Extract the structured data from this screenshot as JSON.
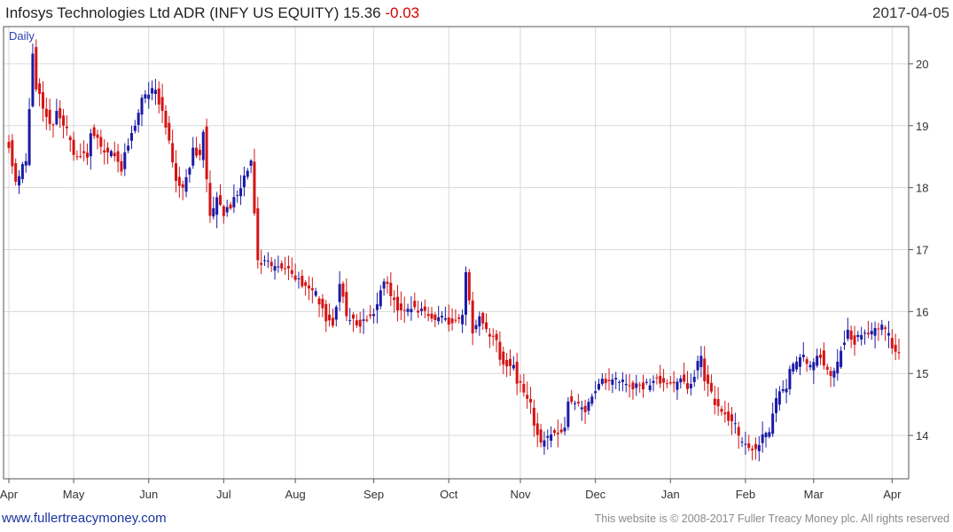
{
  "header": {
    "security": "Infosys Technologies Ltd ADR (INFY US EQUITY)",
    "last_price": "15.36",
    "change": "-0.03",
    "date": "2017-04-05"
  },
  "footer": {
    "site_link": "www.fullertreacymoney.com",
    "copyright": "This website is © 2008-2017 Fuller Treacy Money plc. All rights reserved"
  },
  "colors": {
    "up": "#1a1aa6",
    "down": "#d41414",
    "grid": "#d9d9d9",
    "frame": "#555555"
  },
  "chart_data": {
    "type": "candlestick",
    "period_label": "Daily",
    "ylim": [
      13.3,
      20.6
    ],
    "y_ticks": [
      14,
      15,
      16,
      17,
      18,
      19,
      20
    ],
    "y_axis_side": "right",
    "x_ticks": [
      "Apr",
      "May",
      "Jun",
      "Jul",
      "Aug",
      "Sep",
      "Oct",
      "Nov",
      "Dec",
      "Jan",
      "Feb",
      "Mar",
      "Apr"
    ],
    "grid": true,
    "anchor_closes": [
      [
        "2016-04-05",
        18.7
      ],
      [
        "2016-04-07",
        18.1
      ],
      [
        "2016-04-12",
        18.4
      ],
      [
        "2016-04-14",
        20.2
      ],
      [
        "2016-04-15",
        19.6
      ],
      [
        "2016-04-18",
        19.5
      ],
      [
        "2016-04-21",
        19.0
      ],
      [
        "2016-04-25",
        19.2
      ],
      [
        "2016-04-29",
        18.8
      ],
      [
        "2016-05-03",
        18.5
      ],
      [
        "2016-05-06",
        18.5
      ],
      [
        "2016-05-09",
        18.9
      ],
      [
        "2016-05-13",
        18.6
      ],
      [
        "2016-05-17",
        18.6
      ],
      [
        "2016-05-20",
        18.3
      ],
      [
        "2016-05-24",
        18.7
      ],
      [
        "2016-05-27",
        19.2
      ],
      [
        "2016-06-02",
        19.6
      ],
      [
        "2016-06-06",
        19.4
      ],
      [
        "2016-06-07",
        19.3
      ],
      [
        "2016-06-10",
        18.4
      ],
      [
        "2016-06-15",
        18.0
      ],
      [
        "2016-06-17",
        18.3
      ],
      [
        "2016-06-20",
        18.6
      ],
      [
        "2016-06-22",
        18.5
      ],
      [
        "2016-06-23",
        18.9
      ],
      [
        "2016-06-24",
        18.1
      ],
      [
        "2016-06-27",
        17.5
      ],
      [
        "2016-06-29",
        17.8
      ],
      [
        "2016-07-01",
        17.6
      ],
      [
        "2016-07-05",
        17.7
      ],
      [
        "2016-07-08",
        18.0
      ],
      [
        "2016-07-13",
        18.4
      ],
      [
        "2016-07-15",
        16.8
      ],
      [
        "2016-07-19",
        16.8
      ],
      [
        "2016-07-22",
        16.7
      ],
      [
        "2016-07-28",
        16.7
      ],
      [
        "2016-08-02",
        16.5
      ],
      [
        "2016-08-05",
        16.4
      ],
      [
        "2016-08-09",
        16.3
      ],
      [
        "2016-08-12",
        15.9
      ],
      [
        "2016-08-16",
        15.8
      ],
      [
        "2016-08-18",
        16.4
      ],
      [
        "2016-08-22",
        15.9
      ],
      [
        "2016-08-26",
        15.8
      ],
      [
        "2016-08-31",
        15.9
      ],
      [
        "2016-09-06",
        16.5
      ],
      [
        "2016-09-09",
        16.2
      ],
      [
        "2016-09-13",
        16.0
      ],
      [
        "2016-09-16",
        16.1
      ],
      [
        "2016-09-21",
        16.0
      ],
      [
        "2016-09-26",
        15.9
      ],
      [
        "2016-09-30",
        15.9
      ],
      [
        "2016-10-04",
        15.8
      ],
      [
        "2016-10-07",
        15.9
      ],
      [
        "2016-10-10",
        16.6
      ],
      [
        "2016-10-12",
        15.7
      ],
      [
        "2016-10-14",
        15.9
      ],
      [
        "2016-10-18",
        15.7
      ],
      [
        "2016-10-21",
        15.5
      ],
      [
        "2016-10-25",
        15.2
      ],
      [
        "2016-10-28",
        15.1
      ],
      [
        "2016-11-01",
        14.8
      ],
      [
        "2016-11-03",
        14.6
      ],
      [
        "2016-11-07",
        14.2
      ],
      [
        "2016-11-09",
        13.9
      ],
      [
        "2016-11-14",
        14.0
      ],
      [
        "2016-11-18",
        14.1
      ],
      [
        "2016-11-21",
        14.6
      ],
      [
        "2016-11-23",
        14.5
      ],
      [
        "2016-11-28",
        14.4
      ],
      [
        "2016-11-30",
        14.6
      ],
      [
        "2016-12-02",
        14.8
      ],
      [
        "2016-12-06",
        14.9
      ],
      [
        "2016-12-12",
        14.9
      ],
      [
        "2016-12-16",
        14.8
      ],
      [
        "2016-12-21",
        14.8
      ],
      [
        "2016-12-27",
        14.9
      ],
      [
        "2017-01-03",
        14.8
      ],
      [
        "2017-01-05",
        14.9
      ],
      [
        "2017-01-09",
        14.7
      ],
      [
        "2017-01-11",
        15.0
      ],
      [
        "2017-01-13",
        15.3
      ],
      [
        "2017-01-17",
        14.8
      ],
      [
        "2017-01-19",
        14.5
      ],
      [
        "2017-01-23",
        14.4
      ],
      [
        "2017-01-26",
        14.2
      ],
      [
        "2017-01-31",
        13.9
      ],
      [
        "2017-02-02",
        13.8
      ],
      [
        "2017-02-06",
        13.8
      ],
      [
        "2017-02-08",
        14.0
      ],
      [
        "2017-02-10",
        14.1
      ],
      [
        "2017-02-13",
        14.4
      ],
      [
        "2017-02-15",
        14.7
      ],
      [
        "2017-02-17",
        14.8
      ],
      [
        "2017-02-21",
        15.1
      ],
      [
        "2017-02-24",
        15.3
      ],
      [
        "2017-02-28",
        15.1
      ],
      [
        "2017-03-03",
        15.3
      ],
      [
        "2017-03-08",
        15.0
      ],
      [
        "2017-03-13",
        15.4
      ],
      [
        "2017-03-15",
        15.7
      ],
      [
        "2017-03-17",
        15.5
      ],
      [
        "2017-03-21",
        15.6
      ],
      [
        "2017-03-24",
        15.7
      ],
      [
        "2017-03-29",
        15.8
      ],
      [
        "2017-03-31",
        15.6
      ],
      [
        "2017-04-03",
        15.4
      ],
      [
        "2017-04-05",
        15.36
      ]
    ]
  }
}
